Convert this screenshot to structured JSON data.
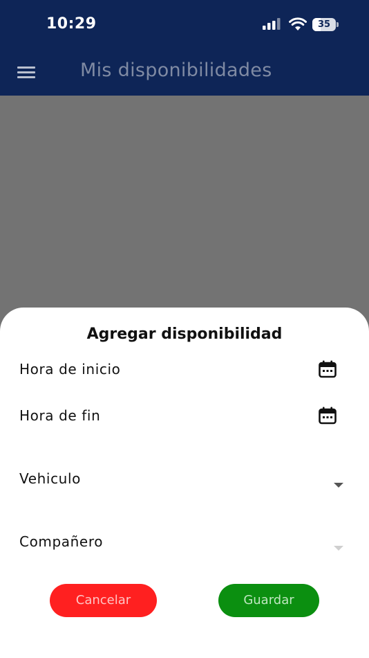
{
  "status_bar": {
    "time": "10:29",
    "battery_level": "35",
    "icons": [
      "signal-icon",
      "wifi-icon",
      "battery-icon"
    ]
  },
  "app_bar": {
    "menu_icon": "hamburger-menu-icon",
    "title": "Mis disponibilidades",
    "background_color": "#0e2557"
  },
  "sheet": {
    "title": "Agregar disponibilidad",
    "fields": {
      "start_time": {
        "label": "Hora de inicio",
        "icon": "calendar-icon"
      },
      "end_time": {
        "label": "Hora de fin",
        "icon": "calendar-icon"
      },
      "vehicle": {
        "label": "Vehiculo",
        "icon": "dropdown-arrow-icon"
      },
      "partner": {
        "label": "Compañero",
        "icon": "dropdown-arrow-icon"
      }
    },
    "buttons": {
      "cancel": {
        "label": "Cancelar",
        "color": "#ff2020"
      },
      "save": {
        "label": "Guardar",
        "color": "#0b8f10"
      }
    }
  }
}
